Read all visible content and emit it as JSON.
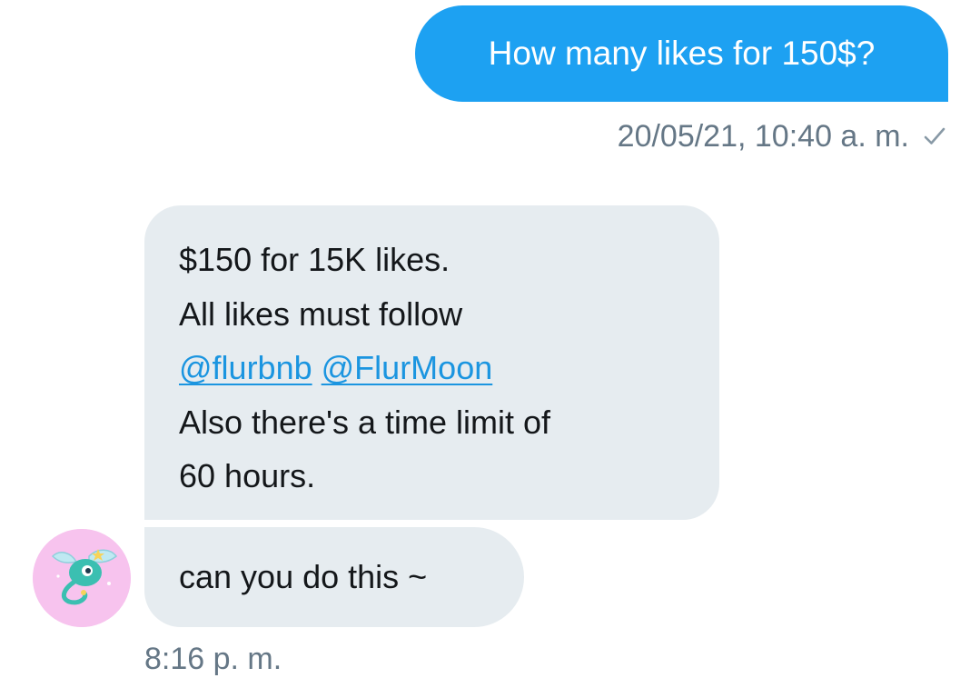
{
  "sent_message": {
    "text": "How many likes for 150$?",
    "timestamp": "20/05/21, 10:40 a. m.",
    "status_icon": "check-icon"
  },
  "received_messages": [
    {
      "lines": [
        "$150 for 15K likes.",
        "All likes must follow",
        "Also there's a time limit of",
        "60 hours."
      ],
      "mentions": [
        "@flurbnb",
        "@FlurMoon"
      ]
    },
    {
      "text": "can you do this ~"
    }
  ],
  "received_timestamp": "8:16 p. m.",
  "avatar": {
    "icon": "winged-creature-avatar"
  },
  "colors": {
    "sent_bubble": "#1da1f2",
    "received_bubble": "#e6ecf0",
    "mention_link": "#1b95e0",
    "meta_text": "#657786",
    "body_text": "#14171a",
    "avatar_bg": "#f7c3ee"
  }
}
